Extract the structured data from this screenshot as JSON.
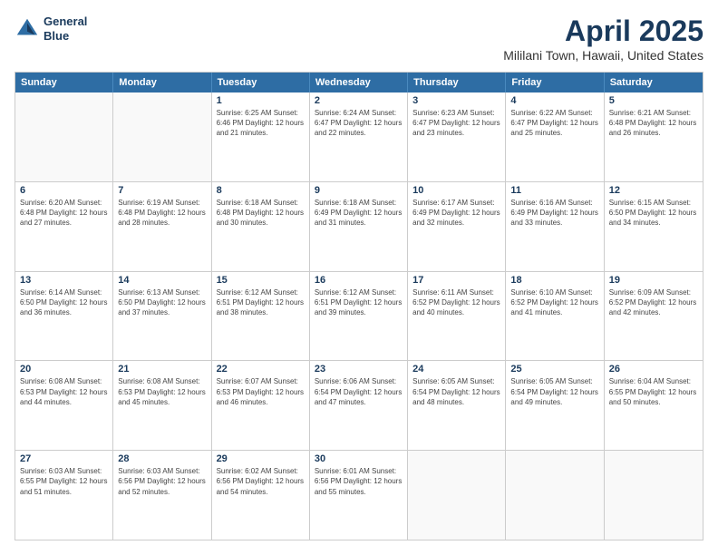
{
  "header": {
    "logo_line1": "General",
    "logo_line2": "Blue",
    "title": "April 2025",
    "subtitle": "Mililani Town, Hawaii, United States"
  },
  "calendar": {
    "days_of_week": [
      "Sunday",
      "Monday",
      "Tuesday",
      "Wednesday",
      "Thursday",
      "Friday",
      "Saturday"
    ],
    "rows": [
      [
        {
          "day": "",
          "info": ""
        },
        {
          "day": "",
          "info": ""
        },
        {
          "day": "1",
          "info": "Sunrise: 6:25 AM\nSunset: 6:46 PM\nDaylight: 12 hours\nand 21 minutes."
        },
        {
          "day": "2",
          "info": "Sunrise: 6:24 AM\nSunset: 6:47 PM\nDaylight: 12 hours\nand 22 minutes."
        },
        {
          "day": "3",
          "info": "Sunrise: 6:23 AM\nSunset: 6:47 PM\nDaylight: 12 hours\nand 23 minutes."
        },
        {
          "day": "4",
          "info": "Sunrise: 6:22 AM\nSunset: 6:47 PM\nDaylight: 12 hours\nand 25 minutes."
        },
        {
          "day": "5",
          "info": "Sunrise: 6:21 AM\nSunset: 6:48 PM\nDaylight: 12 hours\nand 26 minutes."
        }
      ],
      [
        {
          "day": "6",
          "info": "Sunrise: 6:20 AM\nSunset: 6:48 PM\nDaylight: 12 hours\nand 27 minutes."
        },
        {
          "day": "7",
          "info": "Sunrise: 6:19 AM\nSunset: 6:48 PM\nDaylight: 12 hours\nand 28 minutes."
        },
        {
          "day": "8",
          "info": "Sunrise: 6:18 AM\nSunset: 6:48 PM\nDaylight: 12 hours\nand 30 minutes."
        },
        {
          "day": "9",
          "info": "Sunrise: 6:18 AM\nSunset: 6:49 PM\nDaylight: 12 hours\nand 31 minutes."
        },
        {
          "day": "10",
          "info": "Sunrise: 6:17 AM\nSunset: 6:49 PM\nDaylight: 12 hours\nand 32 minutes."
        },
        {
          "day": "11",
          "info": "Sunrise: 6:16 AM\nSunset: 6:49 PM\nDaylight: 12 hours\nand 33 minutes."
        },
        {
          "day": "12",
          "info": "Sunrise: 6:15 AM\nSunset: 6:50 PM\nDaylight: 12 hours\nand 34 minutes."
        }
      ],
      [
        {
          "day": "13",
          "info": "Sunrise: 6:14 AM\nSunset: 6:50 PM\nDaylight: 12 hours\nand 36 minutes."
        },
        {
          "day": "14",
          "info": "Sunrise: 6:13 AM\nSunset: 6:50 PM\nDaylight: 12 hours\nand 37 minutes."
        },
        {
          "day": "15",
          "info": "Sunrise: 6:12 AM\nSunset: 6:51 PM\nDaylight: 12 hours\nand 38 minutes."
        },
        {
          "day": "16",
          "info": "Sunrise: 6:12 AM\nSunset: 6:51 PM\nDaylight: 12 hours\nand 39 minutes."
        },
        {
          "day": "17",
          "info": "Sunrise: 6:11 AM\nSunset: 6:52 PM\nDaylight: 12 hours\nand 40 minutes."
        },
        {
          "day": "18",
          "info": "Sunrise: 6:10 AM\nSunset: 6:52 PM\nDaylight: 12 hours\nand 41 minutes."
        },
        {
          "day": "19",
          "info": "Sunrise: 6:09 AM\nSunset: 6:52 PM\nDaylight: 12 hours\nand 42 minutes."
        }
      ],
      [
        {
          "day": "20",
          "info": "Sunrise: 6:08 AM\nSunset: 6:53 PM\nDaylight: 12 hours\nand 44 minutes."
        },
        {
          "day": "21",
          "info": "Sunrise: 6:08 AM\nSunset: 6:53 PM\nDaylight: 12 hours\nand 45 minutes."
        },
        {
          "day": "22",
          "info": "Sunrise: 6:07 AM\nSunset: 6:53 PM\nDaylight: 12 hours\nand 46 minutes."
        },
        {
          "day": "23",
          "info": "Sunrise: 6:06 AM\nSunset: 6:54 PM\nDaylight: 12 hours\nand 47 minutes."
        },
        {
          "day": "24",
          "info": "Sunrise: 6:05 AM\nSunset: 6:54 PM\nDaylight: 12 hours\nand 48 minutes."
        },
        {
          "day": "25",
          "info": "Sunrise: 6:05 AM\nSunset: 6:54 PM\nDaylight: 12 hours\nand 49 minutes."
        },
        {
          "day": "26",
          "info": "Sunrise: 6:04 AM\nSunset: 6:55 PM\nDaylight: 12 hours\nand 50 minutes."
        }
      ],
      [
        {
          "day": "27",
          "info": "Sunrise: 6:03 AM\nSunset: 6:55 PM\nDaylight: 12 hours\nand 51 minutes."
        },
        {
          "day": "28",
          "info": "Sunrise: 6:03 AM\nSunset: 6:56 PM\nDaylight: 12 hours\nand 52 minutes."
        },
        {
          "day": "29",
          "info": "Sunrise: 6:02 AM\nSunset: 6:56 PM\nDaylight: 12 hours\nand 54 minutes."
        },
        {
          "day": "30",
          "info": "Sunrise: 6:01 AM\nSunset: 6:56 PM\nDaylight: 12 hours\nand 55 minutes."
        },
        {
          "day": "",
          "info": ""
        },
        {
          "day": "",
          "info": ""
        },
        {
          "day": "",
          "info": ""
        }
      ]
    ]
  }
}
